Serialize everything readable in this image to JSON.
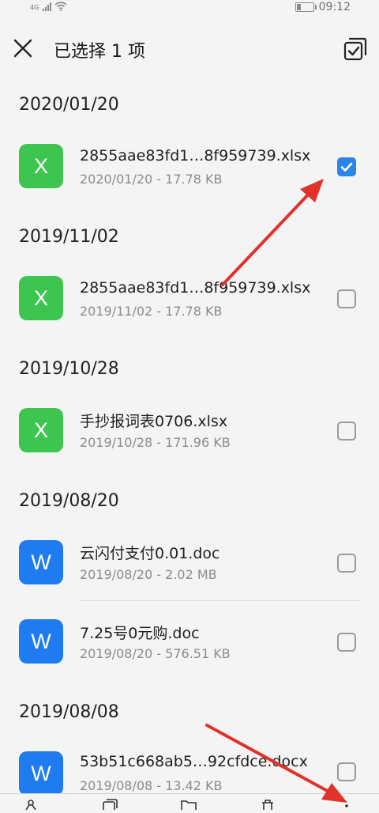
{
  "status_bar": {
    "network": "4G",
    "time": "09:12",
    "battery_level": 0.3
  },
  "header": {
    "title": "已选择 1 项"
  },
  "groups": [
    {
      "date": "2020/01/20",
      "items": [
        {
          "icon_letter": "X",
          "icon_type": "excel",
          "name": "2855aae83fd1…8f959739.xlsx",
          "meta": "2020/01/20 - 17.78 KB",
          "checked": true
        }
      ]
    },
    {
      "date": "2019/11/02",
      "items": [
        {
          "icon_letter": "X",
          "icon_type": "excel",
          "name": "2855aae83fd1…8f959739.xlsx",
          "meta": "2019/11/02 - 17.78 KB",
          "checked": false
        }
      ]
    },
    {
      "date": "2019/10/28",
      "items": [
        {
          "icon_letter": "X",
          "icon_type": "excel",
          "name": "手抄报词表0706.xlsx",
          "meta": "2019/10/28 - 171.96 KB",
          "checked": false
        }
      ]
    },
    {
      "date": "2019/08/20",
      "items": [
        {
          "icon_letter": "W",
          "icon_type": "word",
          "name": "云闪付支付0.01.doc",
          "meta": "2019/08/20 - 2.02 MB",
          "checked": false
        },
        {
          "icon_letter": "W",
          "icon_type": "word",
          "name": "7.25号0元购.doc",
          "meta": "2019/08/20 - 576.51 KB",
          "checked": false
        }
      ]
    },
    {
      "date": "2019/08/08",
      "items": [
        {
          "icon_letter": "W",
          "icon_type": "word",
          "name": "53b51c668ab5…92cfdce.docx",
          "meta": "2019/08/08 - 13.42 KB",
          "checked": false
        }
      ]
    }
  ],
  "colors": {
    "excel": "#3ec550",
    "word": "#1f7bf0",
    "checkbox_checked": "#2a85e8",
    "annotation_arrow": "#e0322b"
  },
  "icons": {
    "close": "close-icon",
    "select_all": "select-all-icon",
    "checkmark": "checkmark-icon",
    "bottom_bar": [
      "share-icon",
      "copy-icon",
      "move-icon",
      "delete-icon",
      "more-icon"
    ]
  }
}
